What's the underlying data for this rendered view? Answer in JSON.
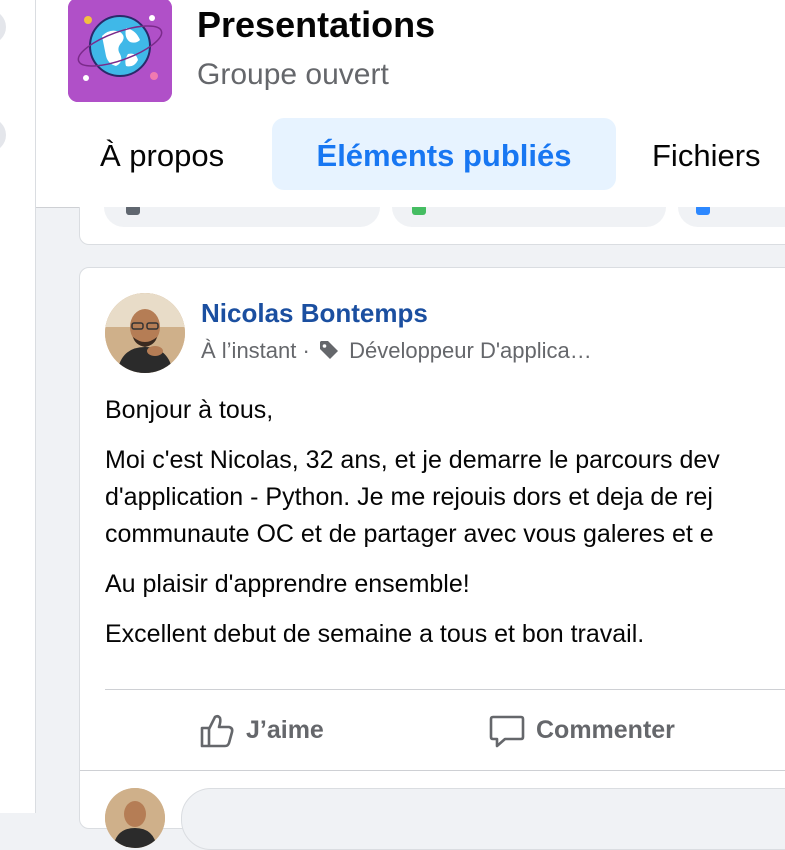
{
  "group": {
    "title": "Presentations",
    "subtitle": "Groupe ouvert"
  },
  "tabs": [
    {
      "label": "À propos",
      "active": false
    },
    {
      "label": "Éléments publiés",
      "active": true
    },
    {
      "label": "Fichiers",
      "active": false
    }
  ],
  "post": {
    "author": "Nicolas Bontemps",
    "time": "À l’instant",
    "separator": "·",
    "topic": "Développeur D'applica…",
    "paragraphs": [
      "Bonjour à tous,",
      "Moi c'est Nicolas, 32 ans, et je demarre le parcours dev",
      "d'application - Python. Je me rejouis dors et deja de rej",
      "communaute OC et de partager avec vous galeres et e",
      "Au plaisir d'apprendre ensemble!",
      "Excellent debut de semaine a tous et bon travail."
    ],
    "actions": {
      "like": "J’aime",
      "comment": "Commenter"
    }
  },
  "colors": {
    "accent": "#1877f2",
    "author": "#1b4fa0",
    "muted": "#65676b",
    "tab_active_bg": "#e7f3ff",
    "group_logo_bg": "#b050c8"
  },
  "icons": [
    "globe-icon",
    "tag-icon",
    "thumbs-up-icon",
    "comment-icon"
  ]
}
